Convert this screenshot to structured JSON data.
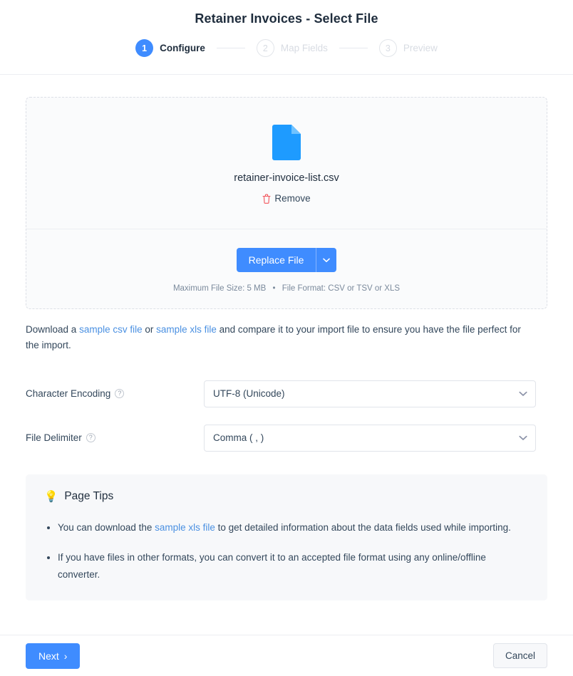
{
  "header": {
    "title": "Retainer Invoices - Select File",
    "steps": [
      {
        "number": "1",
        "label": "Configure",
        "state": "active"
      },
      {
        "number": "2",
        "label": "Map Fields",
        "state": "inactive"
      },
      {
        "number": "3",
        "label": "Preview",
        "state": "inactive"
      }
    ]
  },
  "upload": {
    "file_name": "retainer-invoice-list.csv",
    "remove_label": "Remove",
    "replace_label": "Replace File",
    "meta_size": "Maximum File Size: 5 MB",
    "meta_separator": "•",
    "meta_format": "File Format: CSV or TSV or XLS"
  },
  "download_note": {
    "part1": "Download a ",
    "link_csv": "sample csv file",
    "part2": " or ",
    "link_xls": "sample xls file",
    "part3": " and compare it to your import file to ensure you have the file perfect for the import."
  },
  "form": {
    "encoding": {
      "label": "Character Encoding",
      "value": "UTF-8 (Unicode)"
    },
    "delimiter": {
      "label": "File Delimiter",
      "value": "Comma ( , )"
    },
    "help_glyph": "?"
  },
  "tips": {
    "title": "Page Tips",
    "bulb": "💡",
    "items": [
      {
        "part1": "You can download the ",
        "link": "sample xls file",
        "part2": " to get detailed information about the data fields used while importing."
      },
      {
        "part1": "If you have files in other formats, you can convert it to an accepted file format using any online/offline converter.",
        "link": "",
        "part2": ""
      }
    ]
  },
  "footer": {
    "next_label": "Next",
    "next_chevron": "›",
    "cancel_label": "Cancel"
  },
  "colors": {
    "accent": "#3f8cff",
    "link": "#4a90e2",
    "danger": "#f2545b",
    "text": "#33475b",
    "muted": "#7b8a9c"
  }
}
